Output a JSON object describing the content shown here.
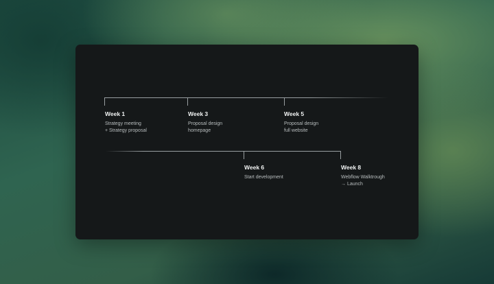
{
  "timeline": {
    "milestones": [
      {
        "title": "Week 1",
        "lines": [
          "Strategy meeting",
          "+ Strategy proposal"
        ]
      },
      {
        "title": "Week 3",
        "lines": [
          "Proposal design",
          "homepage"
        ]
      },
      {
        "title": "Week 5",
        "lines": [
          "Proposal design",
          "full website"
        ]
      },
      {
        "title": "Week 6",
        "lines": [
          "Start development"
        ]
      },
      {
        "title": "Week 8",
        "lines": [
          "Webflow Walktrough",
          "→ Launch"
        ]
      }
    ]
  },
  "colors": {
    "card_background": "#151819",
    "rail": "#9aa0a2",
    "title_text": "#f1f3f3",
    "body_text": "#b9bebf"
  }
}
